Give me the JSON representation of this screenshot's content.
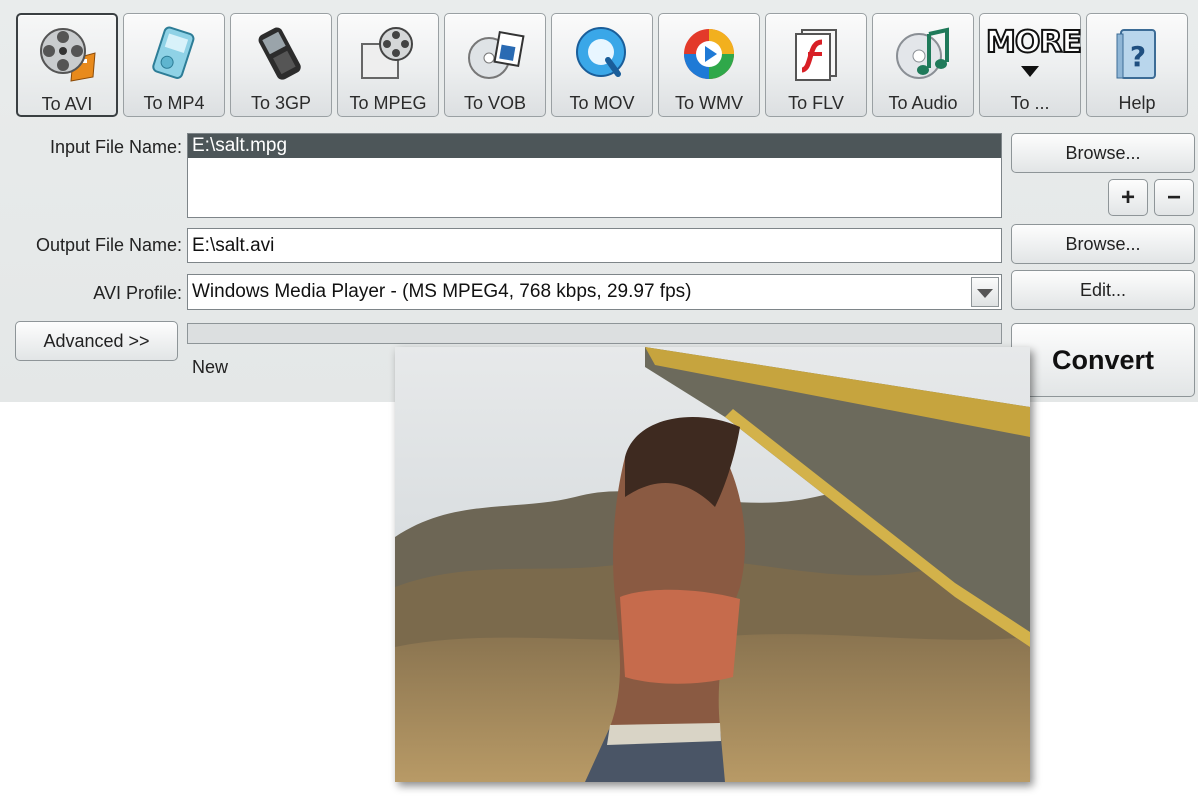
{
  "toolbar": {
    "buttons": [
      {
        "label": "To AVI",
        "icon": "film-reel-icon"
      },
      {
        "label": "To MP4",
        "icon": "mp4-player-icon"
      },
      {
        "label": "To 3GP",
        "icon": "mobile-phone-icon"
      },
      {
        "label": "To MPEG",
        "icon": "mpeg-reel-icon"
      },
      {
        "label": "To VOB",
        "icon": "dvd-disc-icon"
      },
      {
        "label": "To MOV",
        "icon": "quicktime-icon"
      },
      {
        "label": "To WMV",
        "icon": "windows-media-icon"
      },
      {
        "label": "To FLV",
        "icon": "flash-icon"
      },
      {
        "label": "To Audio",
        "icon": "audio-cd-icon"
      },
      {
        "label": "To ...",
        "icon": "more-icon",
        "badge": "MORE"
      },
      {
        "label": "Help",
        "icon": "help-book-icon"
      }
    ]
  },
  "form": {
    "input_label": "Input File Name:",
    "input_files": [
      "E:\\salt.mpg"
    ],
    "output_label": "Output File Name:",
    "output_value": "E:\\salt.avi",
    "profile_label": "AVI Profile:",
    "profile_value": "Windows Media Player - (MS MPEG4, 768 kbps, 29.97 fps)",
    "status": "New",
    "progress": 0
  },
  "buttons": {
    "browse_input": "Browse...",
    "add": "+",
    "remove": "−",
    "browse_output": "Browse...",
    "edit": "Edit...",
    "advanced": "Advanced >>",
    "convert": "Convert"
  },
  "colors": {
    "selection": "#4d5659",
    "window_bg": "#e6e9e9"
  }
}
